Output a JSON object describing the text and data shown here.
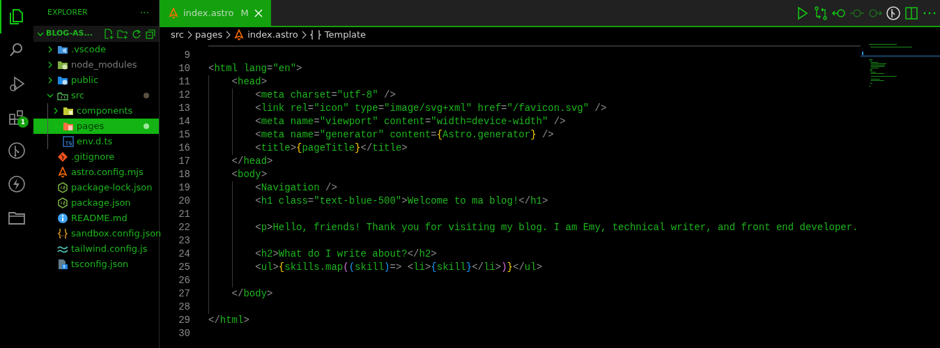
{
  "activity_bar": [
    {
      "kind": "explorer",
      "selected": true
    },
    {
      "kind": "search",
      "selected": false
    },
    {
      "kind": "debug",
      "selected": false
    },
    {
      "kind": "extensions",
      "selected": false,
      "badge": "1"
    },
    {
      "kind": "source-control",
      "selected": false
    },
    {
      "kind": "lightning",
      "selected": false
    },
    {
      "kind": "folder",
      "selected": false
    }
  ],
  "sidebar": {
    "title": "EXPLORER",
    "more": "···",
    "section": {
      "title": "BLOG-AS...",
      "expanded": true
    },
    "items": [
      {
        "label": ".vscode",
        "kind": "vscode-folder",
        "expanded": false,
        "selected": false,
        "modified": false,
        "dimmed": false
      },
      {
        "label": "node_modules",
        "kind": "node-folder",
        "expanded": false,
        "selected": false,
        "modified": false,
        "dimmed": true
      },
      {
        "label": "public",
        "kind": "public-folder",
        "expanded": false,
        "selected": false,
        "modified": false,
        "dimmed": false
      },
      {
        "label": "src",
        "kind": "src-folder",
        "expanded": true,
        "selected": false,
        "modified": true,
        "dimmed": false,
        "children": [
          {
            "label": "components",
            "kind": "components-folder",
            "expanded": false,
            "selected": false,
            "modified": false,
            "dimmed": false
          },
          {
            "label": "pages",
            "kind": "pages-folder",
            "expanded": false,
            "selected": true,
            "modified": true,
            "dimmed": false
          },
          {
            "label": "env.d.ts",
            "kind": "ts",
            "selected": false,
            "modified": false,
            "dimmed": false
          }
        ]
      },
      {
        "label": ".gitignore",
        "kind": "git",
        "selected": false,
        "modified": false,
        "dimmed": false
      },
      {
        "label": "astro.config.mjs",
        "kind": "astro",
        "selected": false,
        "modified": false,
        "dimmed": false
      },
      {
        "label": "package-lock.json",
        "kind": "node",
        "selected": false,
        "modified": false,
        "dimmed": false
      },
      {
        "label": "package.json",
        "kind": "node",
        "selected": false,
        "modified": false,
        "dimmed": false
      },
      {
        "label": "README.md",
        "kind": "info",
        "selected": false,
        "modified": false,
        "dimmed": false
      },
      {
        "label": "sandbox.config.json",
        "kind": "json",
        "selected": false,
        "modified": false,
        "dimmed": false
      },
      {
        "label": "tailwind.config.js",
        "kind": "tailwind",
        "selected": false,
        "modified": false,
        "dimmed": false
      },
      {
        "label": "tsconfig.json",
        "kind": "tsconfig",
        "selected": false,
        "modified": false,
        "dimmed": false
      }
    ]
  },
  "tabs": [
    {
      "label": "index.astro",
      "status": "M",
      "selected": true
    }
  ],
  "editor_actions": [
    {
      "kind": "run",
      "disabled": false
    },
    {
      "kind": "compare",
      "disabled": false
    },
    {
      "kind": "previous-change",
      "disabled": false
    },
    {
      "kind": "commit",
      "disabled": true
    },
    {
      "kind": "next-change",
      "disabled": true
    },
    {
      "kind": "git-graph",
      "disabled": false
    },
    {
      "kind": "split",
      "disabled": false
    },
    {
      "kind": "more",
      "disabled": false
    }
  ],
  "breadcrumb": [
    {
      "label": "src",
      "kind": "folder"
    },
    {
      "label": "pages",
      "kind": "folder"
    },
    {
      "label": "index.astro",
      "kind": "astro"
    },
    {
      "label": "Template",
      "kind": "symbol"
    }
  ],
  "code": [
    {
      "number": "9"
    },
    {
      "number": "10",
      "tokens": [
        {
          "kind": "punct",
          "text": "<"
        },
        {
          "kind": "code",
          "text": "html lang"
        },
        {
          "kind": "punct",
          "text": "="
        },
        {
          "kind": "code",
          "text": "\"en\""
        },
        {
          "kind": "punct",
          "text": ">"
        }
      ]
    },
    {
      "number": "11",
      "tokens": [
        {
          "kind": "punct",
          "text": "    <"
        },
        {
          "kind": "code",
          "text": "head"
        },
        {
          "kind": "punct",
          "text": ">"
        }
      ]
    },
    {
      "number": "12",
      "tokens": [
        {
          "kind": "punct",
          "text": "        <"
        },
        {
          "kind": "code",
          "text": "meta charset"
        },
        {
          "kind": "punct",
          "text": "="
        },
        {
          "kind": "code",
          "text": "\"utf-8\""
        },
        {
          "kind": "punct",
          "text": " />"
        }
      ]
    },
    {
      "number": "13",
      "tokens": [
        {
          "kind": "punct",
          "text": "        <"
        },
        {
          "kind": "code",
          "text": "link rel"
        },
        {
          "kind": "punct",
          "text": "="
        },
        {
          "kind": "code",
          "text": "\"icon\" type"
        },
        {
          "kind": "punct",
          "text": "="
        },
        {
          "kind": "code",
          "text": "\"image/svg+xml\" href"
        },
        {
          "kind": "punct",
          "text": "="
        },
        {
          "kind": "code",
          "text": "\"/favicon.svg\""
        },
        {
          "kind": "punct",
          "text": " />"
        }
      ]
    },
    {
      "number": "14",
      "tokens": [
        {
          "kind": "punct",
          "text": "        <"
        },
        {
          "kind": "code",
          "text": "meta name"
        },
        {
          "kind": "punct",
          "text": "="
        },
        {
          "kind": "code",
          "text": "\"viewport\" content"
        },
        {
          "kind": "punct",
          "text": "="
        },
        {
          "kind": "code",
          "text": "\"width=device-width\""
        },
        {
          "kind": "punct",
          "text": " />"
        }
      ]
    },
    {
      "number": "15",
      "tokens": [
        {
          "kind": "punct",
          "text": "        <"
        },
        {
          "kind": "code",
          "text": "meta name"
        },
        {
          "kind": "punct",
          "text": "="
        },
        {
          "kind": "code",
          "text": "\"generator\" content"
        },
        {
          "kind": "punct",
          "text": "="
        },
        {
          "kind": "bracket1",
          "text": "{"
        },
        {
          "kind": "code",
          "text": "Astro.generator"
        },
        {
          "kind": "bracket1",
          "text": "}"
        },
        {
          "kind": "punct",
          "text": " />"
        }
      ]
    },
    {
      "number": "16",
      "tokens": [
        {
          "kind": "punct",
          "text": "        <"
        },
        {
          "kind": "code",
          "text": "title"
        },
        {
          "kind": "punct",
          "text": ">"
        },
        {
          "kind": "bracket1",
          "text": "{"
        },
        {
          "kind": "code",
          "text": "pageTitle"
        },
        {
          "kind": "bracket1",
          "text": "}"
        },
        {
          "kind": "punct",
          "text": "</"
        },
        {
          "kind": "code",
          "text": "title"
        },
        {
          "kind": "punct",
          "text": ">"
        }
      ]
    },
    {
      "number": "17",
      "tokens": [
        {
          "kind": "punct",
          "text": "    </"
        },
        {
          "kind": "code",
          "text": "head"
        },
        {
          "kind": "punct",
          "text": ">"
        }
      ]
    },
    {
      "number": "18",
      "tokens": [
        {
          "kind": "punct",
          "text": "    <"
        },
        {
          "kind": "code",
          "text": "body"
        },
        {
          "kind": "punct",
          "text": ">"
        }
      ]
    },
    {
      "number": "19",
      "tokens": [
        {
          "kind": "punct",
          "text": "        <"
        },
        {
          "kind": "code",
          "text": "Navigation"
        },
        {
          "kind": "punct",
          "text": " />"
        }
      ]
    },
    {
      "number": "20",
      "tokens": [
        {
          "kind": "punct",
          "text": "        <"
        },
        {
          "kind": "code",
          "text": "h1 class"
        },
        {
          "kind": "punct",
          "text": "="
        },
        {
          "kind": "code",
          "text": "\"text-blue-500\""
        },
        {
          "kind": "punct",
          "text": ">"
        },
        {
          "kind": "code",
          "text": "Welcome to ma blog!"
        },
        {
          "kind": "punct",
          "text": "</"
        },
        {
          "kind": "code",
          "text": "h1"
        },
        {
          "kind": "punct",
          "text": ">"
        }
      ]
    },
    {
      "number": "21"
    },
    {
      "number": "22",
      "tokens": [
        {
          "kind": "punct",
          "text": "        <"
        },
        {
          "kind": "code",
          "text": "p"
        },
        {
          "kind": "punct",
          "text": ">"
        },
        {
          "kind": "code",
          "text": "Hello, friends! Thank you for visiting my blog. I am Emy, technical writer, and front end developer."
        }
      ]
    },
    {
      "number": "23"
    },
    {
      "number": "24",
      "tokens": [
        {
          "kind": "punct",
          "text": "        <"
        },
        {
          "kind": "code",
          "text": "h2"
        },
        {
          "kind": "punct",
          "text": ">"
        },
        {
          "kind": "code",
          "text": "What do I write about?"
        },
        {
          "kind": "punct",
          "text": "</"
        },
        {
          "kind": "code",
          "text": "h2"
        },
        {
          "kind": "punct",
          "text": ">"
        }
      ]
    },
    {
      "number": "25",
      "tokens": [
        {
          "kind": "punct",
          "text": "        <"
        },
        {
          "kind": "code",
          "text": "ul"
        },
        {
          "kind": "punct",
          "text": ">"
        },
        {
          "kind": "bracket1",
          "text": "{"
        },
        {
          "kind": "code",
          "text": "skills.map"
        },
        {
          "kind": "bracket2",
          "text": "("
        },
        {
          "kind": "bracket3",
          "text": "("
        },
        {
          "kind": "code",
          "text": "skill"
        },
        {
          "kind": "bracket3",
          "text": ")"
        },
        {
          "kind": "punct",
          "text": "=> <"
        },
        {
          "kind": "code",
          "text": "li"
        },
        {
          "kind": "punct",
          "text": ">"
        },
        {
          "kind": "bracket3",
          "text": "{"
        },
        {
          "kind": "code",
          "text": "skill"
        },
        {
          "kind": "bracket3",
          "text": "}"
        },
        {
          "kind": "punct",
          "text": "</"
        },
        {
          "kind": "code",
          "text": "li"
        },
        {
          "kind": "punct",
          "text": ">"
        },
        {
          "kind": "bracket2",
          "text": ")"
        },
        {
          "kind": "bracket1",
          "text": "}"
        },
        {
          "kind": "punct",
          "text": "</"
        },
        {
          "kind": "code",
          "text": "ul"
        },
        {
          "kind": "punct",
          "text": ">"
        }
      ]
    },
    {
      "number": "26"
    },
    {
      "number": "27",
      "tokens": [
        {
          "kind": "punct",
          "text": "    </"
        },
        {
          "kind": "code",
          "text": "body"
        },
        {
          "kind": "punct",
          "text": ">"
        }
      ]
    },
    {
      "number": "28"
    },
    {
      "number": "29",
      "tokens": [
        {
          "kind": "punct",
          "text": "</"
        },
        {
          "kind": "code",
          "text": "html"
        },
        {
          "kind": "punct",
          "text": ">"
        }
      ]
    },
    {
      "number": "30"
    }
  ]
}
